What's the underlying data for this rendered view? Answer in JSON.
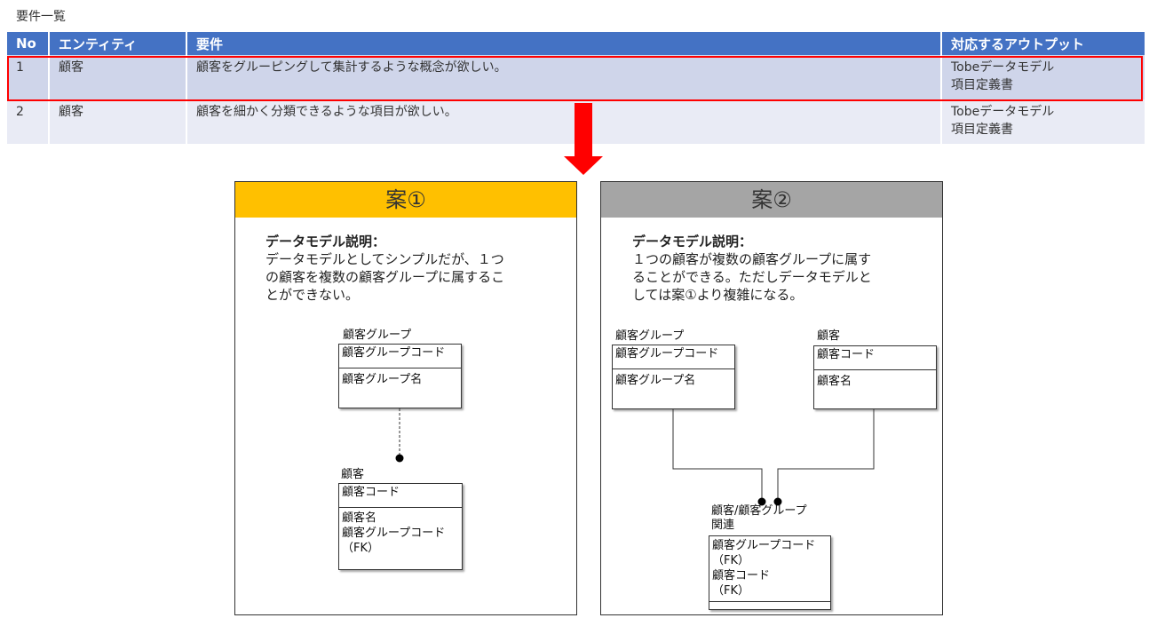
{
  "page_title": "要件一覧",
  "table": {
    "headers": [
      "No",
      "エンティティ",
      "要件",
      "対応するアウトプット"
    ],
    "rows": [
      {
        "no": "1",
        "entity": "顧客",
        "requirement": "顧客をグルーピングして集計するような概念が欲しい。",
        "outputs": [
          "Tobeデータモデル",
          "項目定義書"
        ]
      },
      {
        "no": "2",
        "entity": "顧客",
        "requirement": "顧客を細かく分類できるような項目が欲しい。",
        "outputs": [
          "Tobeデータモデル",
          "項目定義書"
        ]
      }
    ]
  },
  "colors": {
    "table_header": "#4472c4",
    "row1": "#cfd5ea",
    "row2": "#e9ebf5",
    "highlight": "#ff0000",
    "arrow": "#ff0000",
    "proposal1_header": "#ffc000",
    "proposal2_header": "#a5a5a5"
  },
  "proposal1": {
    "title": "案①",
    "desc_title": "データモデル説明：",
    "desc_body": "データモデルとしてシンプルだが、１つ\nの顧客を複数の顧客グループに属するこ\nとができない。",
    "group_entity": {
      "name": "顧客グループ",
      "key": "顧客グループコード",
      "attrs": "顧客グループ名"
    },
    "customer_entity": {
      "name": "顧客",
      "key": "顧客コード",
      "attrs": "顧客名\n顧客グループコード\n（FK）"
    }
  },
  "proposal2": {
    "title": "案②",
    "desc_title": "データモデル説明：",
    "desc_body": "１つの顧客が複数の顧客グループに属す\nることができる。ただしデータモデルと\nしては案①より複雑になる。",
    "group_entity": {
      "name": "顧客グループ",
      "key": "顧客グループコード",
      "attrs": "顧客グループ名"
    },
    "customer_entity": {
      "name": "顧客",
      "key": "顧客コード",
      "attrs": "顧客名"
    },
    "relation_entity": {
      "name": "顧客/顧客グループ\n関連",
      "key": "顧客グループコード\n（FK）\n顧客コード\n（FK）",
      "attrs": ""
    }
  }
}
